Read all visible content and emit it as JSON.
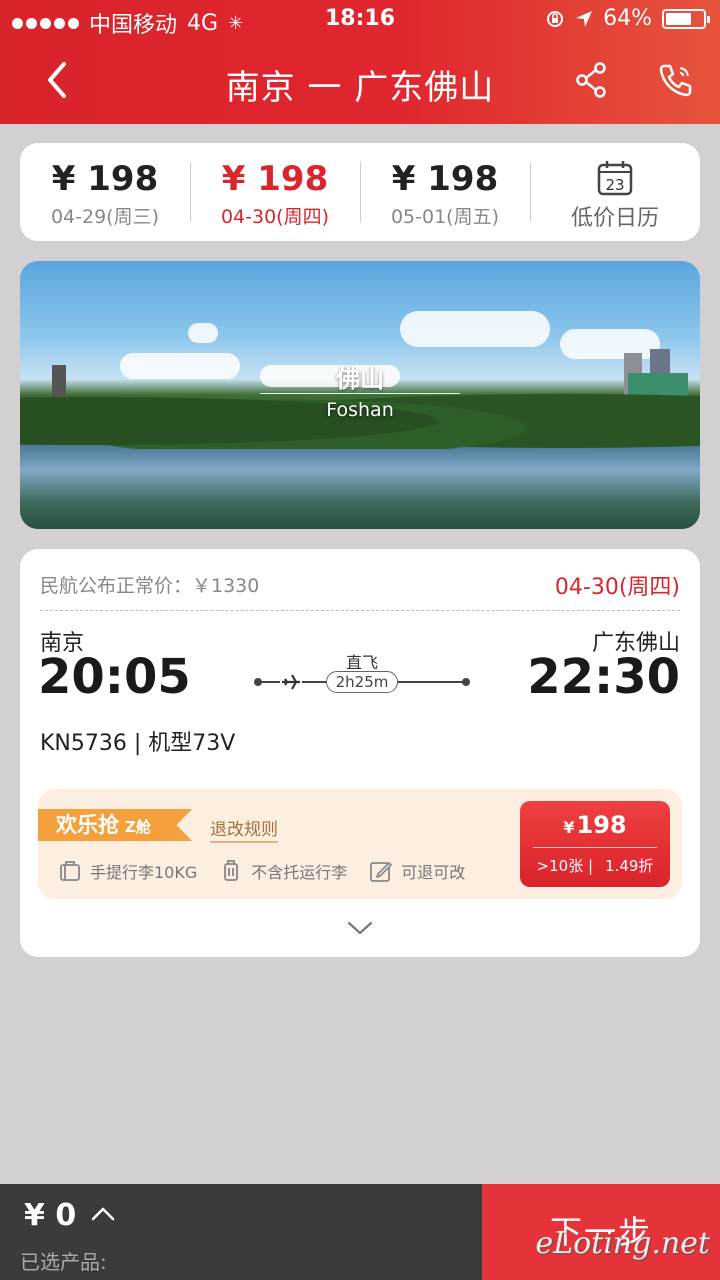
{
  "status_bar": {
    "carrier": "中国移动",
    "network": "4G",
    "time": "18:16",
    "battery": "64%"
  },
  "header": {
    "title": "南京 一 广东佛山",
    "back_icon": "chevron-left-icon",
    "share_icon": "share-icon",
    "phone_icon": "phone-icon"
  },
  "date_strip": {
    "items": [
      {
        "price": "¥ 198",
        "date": "04-29(周三)",
        "active": false
      },
      {
        "price": "¥ 198",
        "date": "04-30(周四)",
        "active": true
      },
      {
        "price": "¥ 198",
        "date": "05-01(周五)",
        "active": false
      }
    ],
    "calendar_day": "23",
    "calendar_label": "低价日历"
  },
  "banner": {
    "city_zh": "佛山",
    "city_en": "Foshan"
  },
  "flight": {
    "standard_price": "民航公布正常价：￥1330",
    "date": "04-30(周四)",
    "from_city": "南京",
    "to_city": "广东佛山",
    "dep_time": "20:05",
    "arr_time": "22:30",
    "type": "直飞",
    "duration": "2h25m",
    "info": "KN5736  |  机型73V"
  },
  "product": {
    "tag": "欢乐抢",
    "cabin": "Z舱",
    "rules_link": "退改规则",
    "perks": [
      "手提行李10KG",
      "不含托运行李",
      "可退可改"
    ],
    "price_symbol": "¥",
    "price": "198",
    "stock": ">10张 |",
    "discount": "1.49折"
  },
  "bottom_bar": {
    "total": "¥ 0",
    "selected_label": "已选产品:",
    "next_label": "下一步",
    "watermark": "eLoting.net"
  },
  "colors": {
    "brand_red": "#d9232b",
    "tag_orange": "#f4a03d",
    "product_bg": "#fdeee2"
  }
}
